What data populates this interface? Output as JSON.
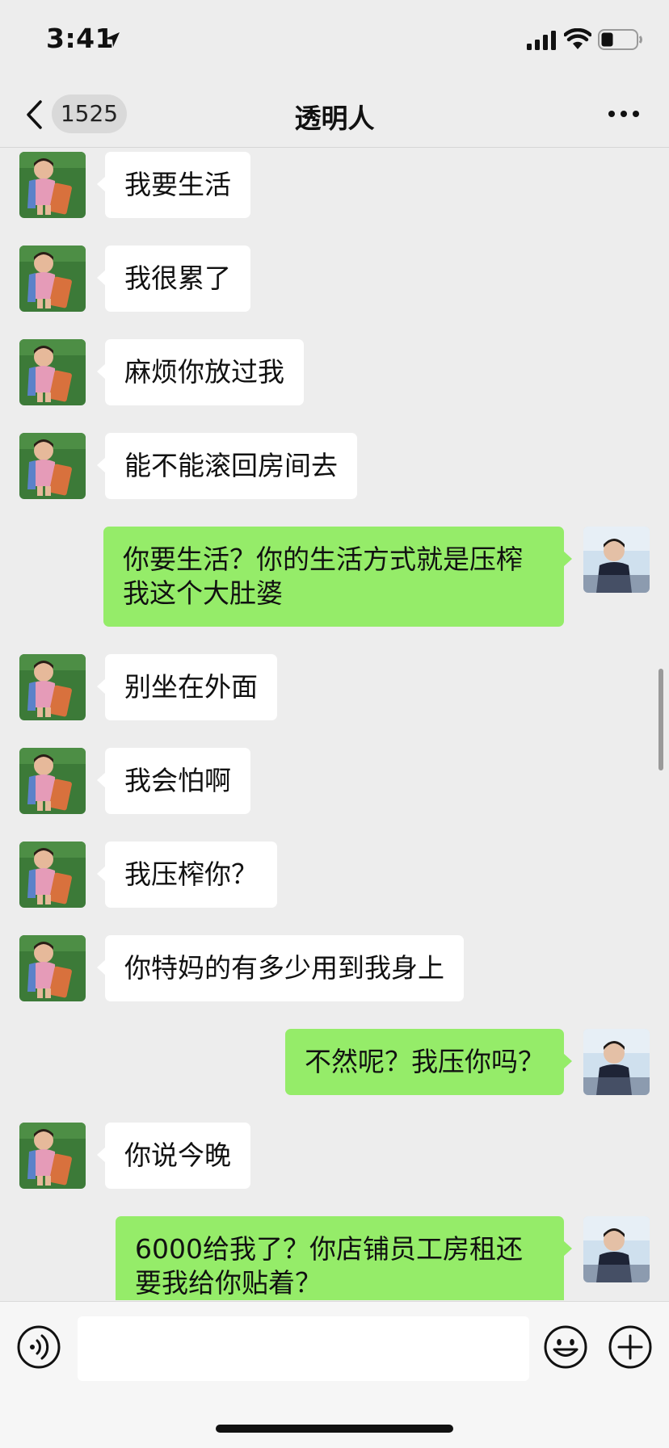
{
  "status_bar": {
    "time": "3:41"
  },
  "navbar": {
    "unread_count": "1525",
    "title": "透明人"
  },
  "messages": [
    {
      "side": "left",
      "text": "我要生活"
    },
    {
      "side": "left",
      "text": "我很累了"
    },
    {
      "side": "left",
      "text": "麻烦你放过我"
    },
    {
      "side": "left",
      "text": "能不能滚回房间去"
    },
    {
      "side": "right",
      "text": "你要生活？你的生活方式就是压榨我这个大肚婆"
    },
    {
      "side": "left",
      "text": "别坐在外面"
    },
    {
      "side": "left",
      "text": "我会怕啊"
    },
    {
      "side": "left",
      "text": "我压榨你？"
    },
    {
      "side": "left",
      "text": "你特妈的有多少用到我身上"
    },
    {
      "side": "right",
      "text": "不然呢？我压你吗？"
    },
    {
      "side": "left",
      "text": "你说今晚"
    },
    {
      "side": "right",
      "text": "6000给我了？你店铺员工房租还要我给你贴着？"
    }
  ],
  "input": {
    "value": "",
    "placeholder": ""
  },
  "colors": {
    "background": "#ededed",
    "bubble_self": "#95ec69",
    "bubble_other": "#ffffff",
    "input_bar": "#f6f6f6"
  }
}
